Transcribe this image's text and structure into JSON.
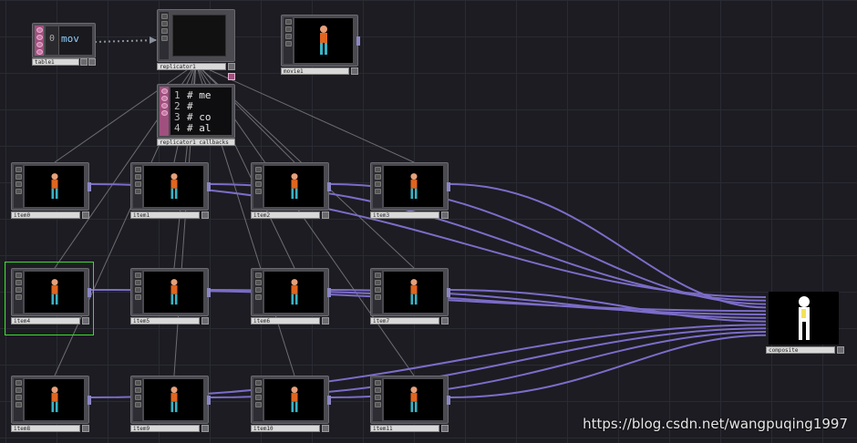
{
  "nodes": {
    "table1": {
      "label": "table1",
      "row_index": "0",
      "cell_value": "mov"
    },
    "replicator1": {
      "label": "replicator1"
    },
    "movie1": {
      "label": "movie1"
    },
    "callbacks": {
      "label": "replicator1_callbacks",
      "lines": [
        {
          "num": "1",
          "text": "# me"
        },
        {
          "num": "2",
          "text": "#"
        },
        {
          "num": "3",
          "text": "# co"
        },
        {
          "num": "4",
          "text": "# al"
        }
      ]
    },
    "items": [
      {
        "label": "item0"
      },
      {
        "label": "item1"
      },
      {
        "label": "item2"
      },
      {
        "label": "item3"
      },
      {
        "label": "item4"
      },
      {
        "label": "item5"
      },
      {
        "label": "item6"
      },
      {
        "label": "item7"
      },
      {
        "label": "item8"
      },
      {
        "label": "item9"
      },
      {
        "label": "item10"
      },
      {
        "label": "item11"
      }
    ],
    "composite": {
      "label": "composite"
    }
  },
  "selected_node": "item4",
  "colors": {
    "wire": "#7c6cc8",
    "ref_line": "#6d6d72",
    "selection": "#3ddc2f",
    "dat_strip": "#a0507e"
  },
  "watermark": "https://blog.csdn.net/wangpuqing1997"
}
